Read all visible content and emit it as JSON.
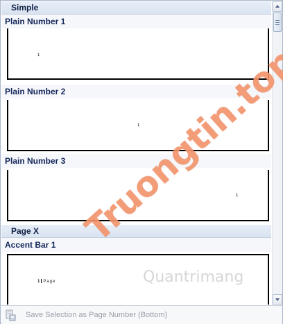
{
  "sections": [
    {
      "header": "Simple"
    },
    {
      "header": "Page X"
    }
  ],
  "items": [
    {
      "label": "Plain Number 1",
      "number": "1"
    },
    {
      "label": "Plain Number 2",
      "number": "1"
    },
    {
      "label": "Plain Number 3",
      "number": "1"
    },
    {
      "label": "Accent Bar 1",
      "number": "1",
      "page_word": "Page"
    }
  ],
  "footer": {
    "label": "Save Selection as Page Number (Bottom)",
    "icon": "save-page-icon"
  },
  "watermark": {
    "main": "Truongtin.top",
    "secondary": "Quantrimang"
  },
  "colors": {
    "section_header_bg": "#dfe7f3",
    "label_text": "#15275a",
    "watermark": "#f5966e"
  }
}
